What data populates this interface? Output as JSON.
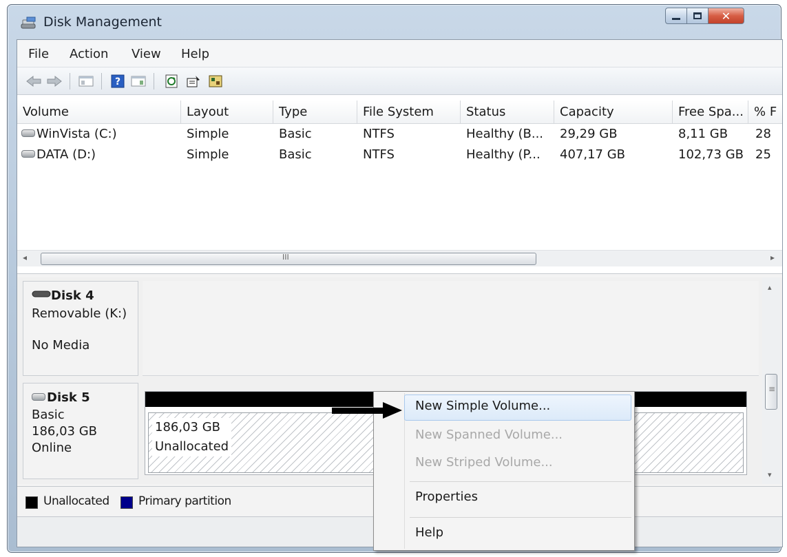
{
  "window": {
    "title": "Disk Management"
  },
  "menubar": {
    "items": [
      "File",
      "Action",
      "View",
      "Help"
    ]
  },
  "toolbar": {
    "icons": [
      "back-arrow-icon",
      "forward-arrow-icon",
      "console-tree-icon",
      "help-icon",
      "action-pane-icon",
      "refresh-icon",
      "properties-icon",
      "disk-wizard-icon"
    ]
  },
  "volume_list": {
    "columns": [
      "Volume",
      "Layout",
      "Type",
      "File System",
      "Status",
      "Capacity",
      "Free Spa...",
      "% F"
    ],
    "rows": [
      {
        "volume": "WinVista (C:)",
        "layout": "Simple",
        "type": "Basic",
        "fs": "NTFS",
        "status": "Healthy (B...",
        "capacity": "29,29 GB",
        "free": "8,11 GB",
        "pct": "28"
      },
      {
        "volume": "DATA (D:)",
        "layout": "Simple",
        "type": "Basic",
        "fs": "NTFS",
        "status": "Healthy (P...",
        "capacity": "407,17 GB",
        "free": "102,73 GB",
        "pct": "25"
      }
    ],
    "scroll_grip": "III"
  },
  "disks": [
    {
      "name": "Disk 4",
      "line2": "Removable (K:)",
      "line3": "No Media"
    },
    {
      "name": "Disk 5",
      "line2": "Basic",
      "line3": "186,03 GB",
      "line4": "Online",
      "partition": {
        "size": "186,03 GB",
        "label": "Unallocated"
      }
    }
  ],
  "legend": {
    "unallocated": "Unallocated",
    "primary": "Primary partition",
    "colors": {
      "unallocated": "#000000",
      "primary": "#00008b"
    }
  },
  "context_menu": {
    "new_simple": "New Simple Volume...",
    "new_spanned": "New Spanned Volume...",
    "new_striped": "New Striped Volume...",
    "properties": "Properties",
    "help": "Help"
  }
}
